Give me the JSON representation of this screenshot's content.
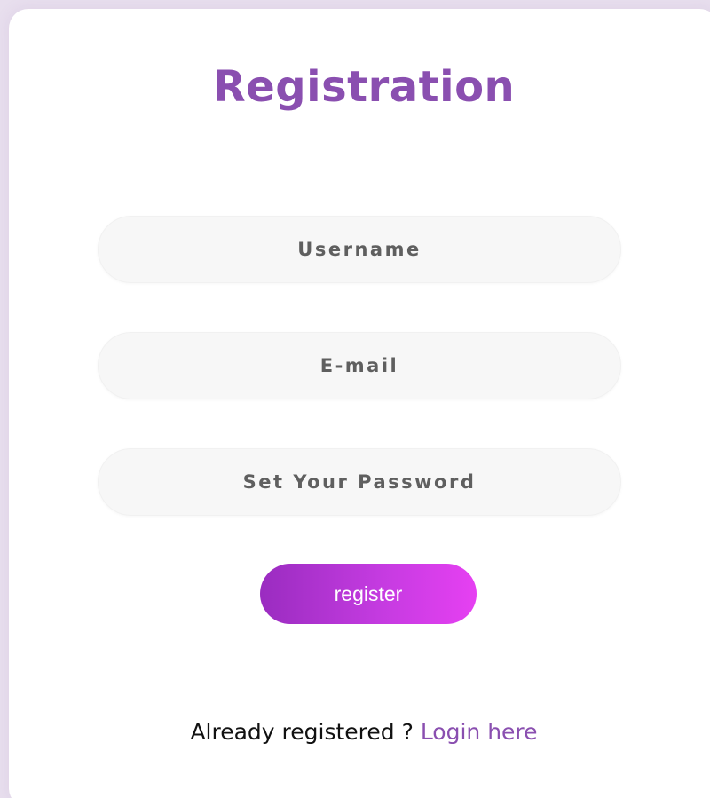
{
  "form": {
    "title": "Registration",
    "username_placeholder": "Username",
    "email_placeholder": "E-mail",
    "password_placeholder": "Set Your Password",
    "register_label": "register"
  },
  "footer": {
    "prompt": "Already registered ? ",
    "login_link": "Login here"
  },
  "colors": {
    "accent": "#8a4fb0",
    "button_gradient_start": "#9a2cc0",
    "button_gradient_end": "#e640f2",
    "page_background": "#e8dfee",
    "field_background": "#f7f7f7"
  }
}
